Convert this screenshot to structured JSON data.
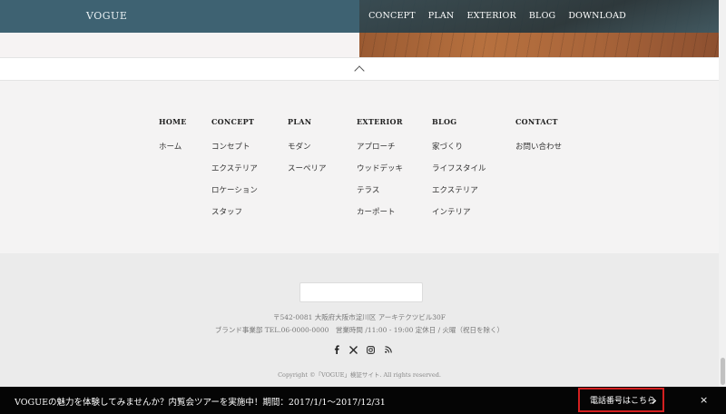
{
  "header": {
    "logo": "VOGUE",
    "nav": [
      "CONCEPT",
      "PLAN",
      "EXTERIOR",
      "BLOG",
      "DOWNLOAD"
    ]
  },
  "footer_nav": {
    "columns": [
      {
        "heading": "HOME",
        "items": [
          "ホーム"
        ]
      },
      {
        "heading": "CONCEPT",
        "items": [
          "コンセプト",
          "エクステリア",
          "ロケーション",
          "スタッフ"
        ]
      },
      {
        "heading": "PLAN",
        "items": [
          "モダン",
          "スーペリア"
        ]
      },
      {
        "heading": "EXTERIOR",
        "items": [
          "アプローチ",
          "ウッドデッキ",
          "テラス",
          "カーポート"
        ]
      },
      {
        "heading": "BLOG",
        "items": [
          "家づくり",
          "ライフスタイル",
          "エクステリア",
          "インテリア"
        ]
      },
      {
        "heading": "CONTACT",
        "items": [
          "お問い合わせ"
        ]
      }
    ]
  },
  "footer_info": {
    "address_line1": "〒542-0081 大阪府大阪市淀川区 アーキテクツビル30F",
    "address_line2": "ブランド事業部 TEL.06-0000-0000　営業時間 /11:00 - 19:00 定休日 / 火曜（祝日を除く）",
    "social_icons": [
      "facebook-icon",
      "x-icon",
      "instagram-icon",
      "rss-icon"
    ],
    "copyright": "Copyright ©「VOGUE」検証サイト. All rights reserved."
  },
  "promo_bar": {
    "text": "VOGUEの魅力を体験してみませんか？内覧会ツアーを実施中！期間：2017/1/1〜2017/12/31",
    "phone_button": "電話番号はこちら",
    "close": "×"
  },
  "colors": {
    "header_bg": "#3e6272",
    "promo_bg": "#050505",
    "phone_button_border": "#d42020"
  }
}
